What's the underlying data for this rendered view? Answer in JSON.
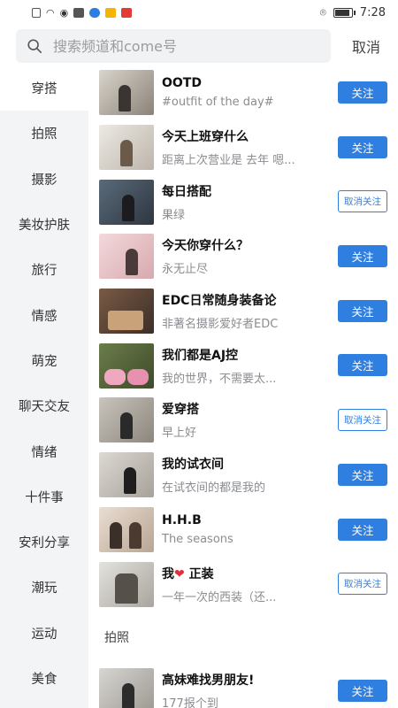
{
  "status_bar": {
    "time": "7:28"
  },
  "search": {
    "placeholder": "搜索频道和come号",
    "cancel_label": "取消"
  },
  "sidebar": {
    "items": [
      {
        "label": "穿搭"
      },
      {
        "label": "拍照"
      },
      {
        "label": "摄影"
      },
      {
        "label": "美妆护肤"
      },
      {
        "label": "旅行"
      },
      {
        "label": "情感"
      },
      {
        "label": "萌宠"
      },
      {
        "label": "聊天交友"
      },
      {
        "label": "情绪"
      },
      {
        "label": "十件事"
      },
      {
        "label": "安利分享"
      },
      {
        "label": "潮玩"
      },
      {
        "label": "运动"
      },
      {
        "label": "美食"
      }
    ]
  },
  "follow_label": "关注",
  "unfollow_label": "取消关注",
  "channels": [
    {
      "title": "OOTD",
      "desc": "#outfit of the day#",
      "followed": false
    },
    {
      "title": "今天上班穿什么",
      "desc": "距离上次营业是 去年 嗯...",
      "followed": false
    },
    {
      "title": "每日搭配",
      "desc": "果绿",
      "followed": true
    },
    {
      "title": "今天你穿什么？",
      "desc": "永无止尽",
      "followed": false
    },
    {
      "title": "EDC日常随身装备论",
      "desc": "非著名摄影爱好者EDC",
      "followed": false
    },
    {
      "title": "我们都是AJ控",
      "desc": "我的世界，不需要太...",
      "followed": false
    },
    {
      "title": "爱穿搭",
      "desc": "早上好",
      "followed": true
    },
    {
      "title": "我的试衣间",
      "desc": "在试衣间的都是我的",
      "followed": false
    },
    {
      "title": "H.H.B",
      "desc": "The seasons",
      "followed": false
    },
    {
      "title_prefix": "我",
      "title_heart": "❤",
      "title_suffix": " 正装",
      "desc": "一年一次的西装（还...",
      "followed": true
    }
  ],
  "section_header": "拍照",
  "section_channels": [
    {
      "title": "高妹难找男朋友!",
      "desc": "177报个到",
      "followed": false
    }
  ],
  "colors": {
    "accent": "#2f7fe0",
    "sidebar_bg": "#f3f4f6",
    "heart": "#e02e3c"
  }
}
